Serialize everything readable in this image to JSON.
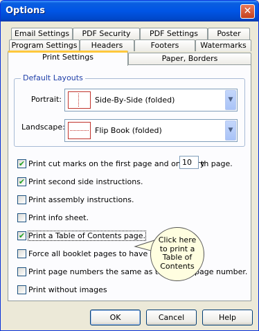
{
  "window": {
    "title": "Options",
    "close_glyph": "✕"
  },
  "tabs": {
    "row1": [
      "Email Settings",
      "PDF Security",
      "PDF Settings",
      "Poster"
    ],
    "row2": [
      "Program Settings",
      "Headers",
      "Footers",
      "Watermarks"
    ],
    "row3": [
      "Print Settings",
      "Paper, Borders"
    ],
    "selected": "Print Settings",
    "accent": "#ffc83c"
  },
  "default_layouts": {
    "group_label": "Default Layouts",
    "portrait": {
      "label": "Portrait:",
      "value": "Side-By-Side (folded)"
    },
    "landscape": {
      "label": "Landscape:",
      "value": "Flip Book (folded)"
    },
    "dropdown_icon": "chevron-down-icon"
  },
  "options": {
    "cut_marks": {
      "checked": true,
      "label_pre": "Print cut marks on the first page and on every",
      "interval": "10",
      "label_post": "th page."
    },
    "second_side": {
      "checked": true,
      "label": "Print second side instructions."
    },
    "assembly": {
      "checked": false,
      "label": "Print assembly instructions."
    },
    "info_sheet": {
      "checked": false,
      "label": "Print info sheet."
    },
    "toc": {
      "checked": true,
      "label": "Print a Table of Contents page."
    },
    "force_booklet": {
      "checked": false,
      "label": "Force all booklet pages to have the s"
    },
    "page_numbers": {
      "checked": false,
      "label_pre": "Print page numbers the same as the con",
      "label_post": "page number."
    },
    "without_images": {
      "checked": false,
      "label": "Print without images"
    }
  },
  "callout": {
    "lines": [
      "Click here",
      "to print a",
      "Table of",
      "Contents"
    ]
  },
  "buttons": {
    "ok": "OK",
    "cancel": "Cancel",
    "help": "Help"
  },
  "colors": {
    "titlebar": "#0055e5",
    "close": "#c5411e",
    "panel_bg": "#fcfcfe",
    "window_bg": "#ece9d8"
  }
}
